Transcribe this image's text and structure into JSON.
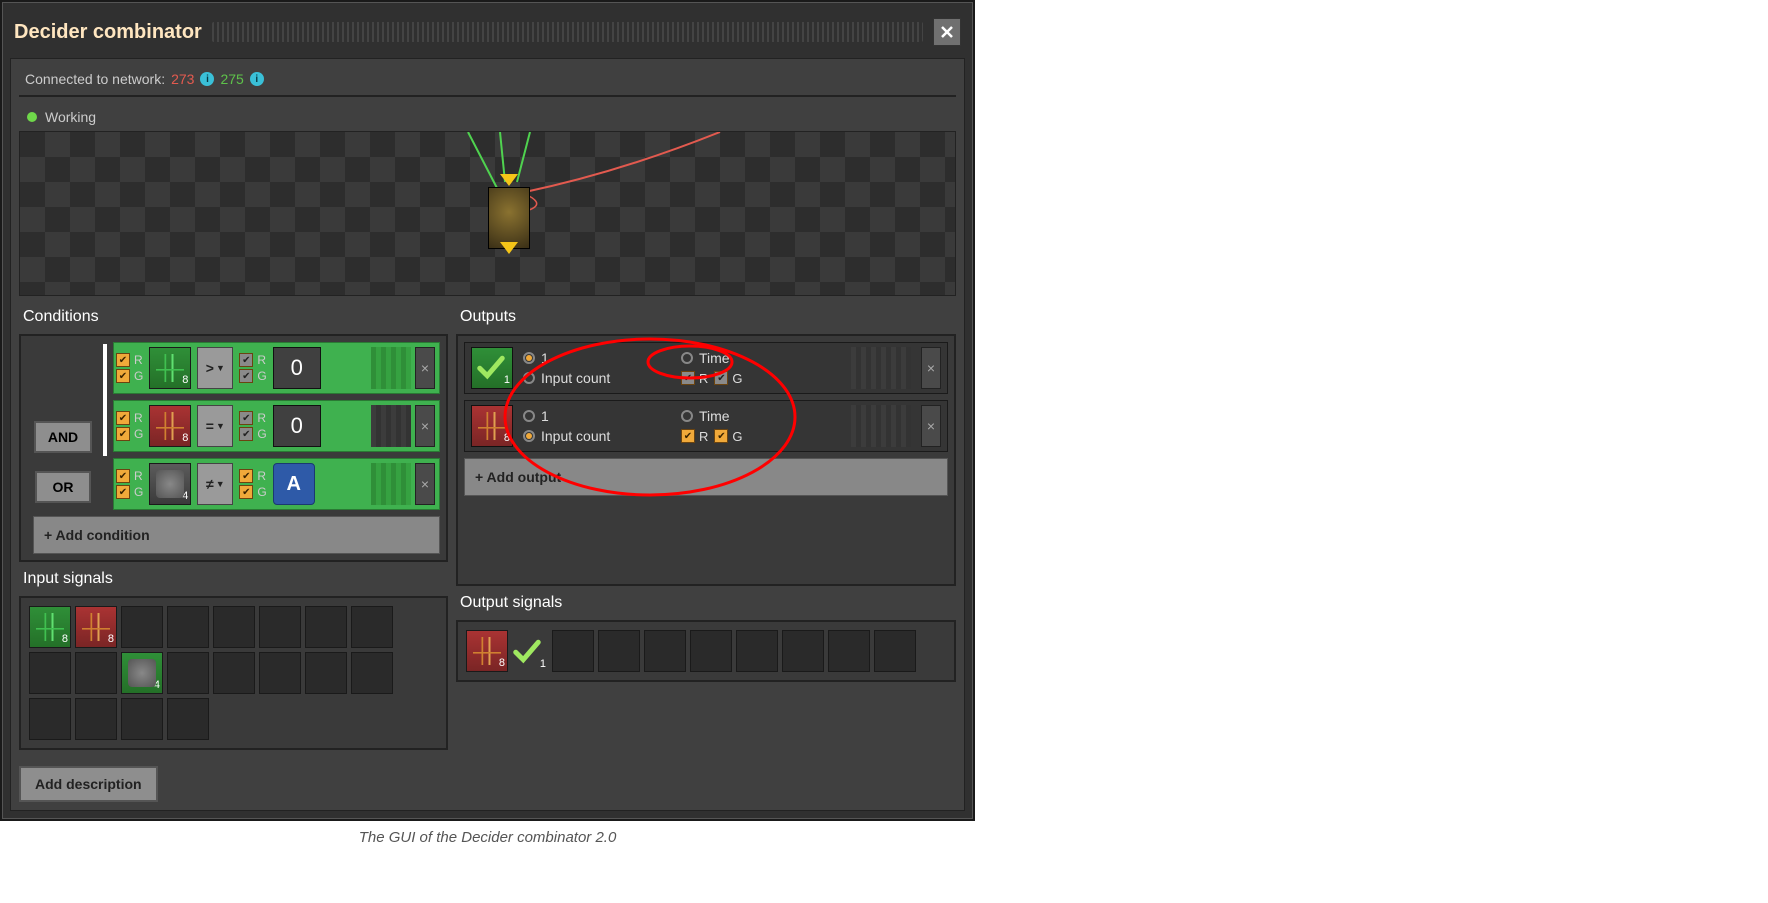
{
  "title": "Decider combinator",
  "network": {
    "label": "Connected to network:",
    "red_id": "273",
    "green_id": "275"
  },
  "status": {
    "text": "Working"
  },
  "conditions": {
    "title": "Conditions",
    "logic_and": "AND",
    "logic_or": "OR",
    "add_label": "+ Add condition",
    "rows": [
      {
        "left_r": true,
        "left_g": true,
        "left_signal_color": "green",
        "left_badge": "8",
        "op": ">",
        "right_r": true,
        "right_g": true,
        "right_const": "0"
      },
      {
        "left_r": true,
        "left_g": true,
        "left_signal_color": "red",
        "left_badge": "8",
        "op": "=",
        "right_r": true,
        "right_g": true,
        "right_const": "0"
      },
      {
        "left_r": true,
        "left_g": true,
        "left_signal_color": "grey",
        "left_badge": "4",
        "op": "≠",
        "right_r": true,
        "right_g": true,
        "right_letter": "A"
      }
    ]
  },
  "outputs": {
    "title": "Outputs",
    "add_label": "+ Add output",
    "one_label": "1",
    "input_count_label": "Input count",
    "time_label": "Time",
    "r_label": "R",
    "g_label": "G",
    "rows": [
      {
        "signal_kind": "check",
        "badge": "1",
        "mode": "one",
        "r": true,
        "g": true,
        "r_style": "std",
        "g_style": "std"
      },
      {
        "signal_kind": "red-circuit",
        "badge": "8",
        "mode": "input_count",
        "r": true,
        "g": true,
        "r_style": "on",
        "g_style": "on"
      }
    ]
  },
  "input_signals": {
    "title": "Input signals",
    "items": [
      {
        "color": "green",
        "badge": "8"
      },
      {
        "color": "red",
        "badge": "8"
      },
      {
        "color": "grey",
        "badge": "4"
      }
    ]
  },
  "output_signals": {
    "title": "Output signals",
    "items": [
      {
        "kind": "red-circuit",
        "badge": "8"
      },
      {
        "kind": "check",
        "badge": "1"
      }
    ]
  },
  "add_description": "Add description",
  "caption": "The GUI of the Decider combinator 2.0"
}
